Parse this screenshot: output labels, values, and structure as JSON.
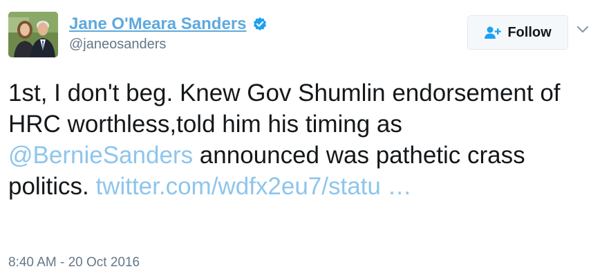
{
  "user": {
    "display_name": "Jane O'Meara Sanders",
    "handle": "@janeosanders",
    "verified_icon": "verified-badge-icon"
  },
  "follow_button": {
    "label": "Follow",
    "icon": "add-user-icon"
  },
  "menu_icon": "chevron-down-icon",
  "tweet": {
    "text_1": "1st, I don't beg. Knew Gov Shumlin endorsement of HRC worthless,told him his timing as ",
    "mention": "@BernieSanders",
    "text_2": " announced was pathetic crass politics. ",
    "link": "twitter.com/wdfx2eu7/statu …"
  },
  "timestamp": "8:40 AM - 20 Oct 2016",
  "colors": {
    "name": "#5ea9dd",
    "link": "#8ec5ec",
    "verified": "#1da1f2",
    "text": "#14171a",
    "muted": "#657786"
  }
}
